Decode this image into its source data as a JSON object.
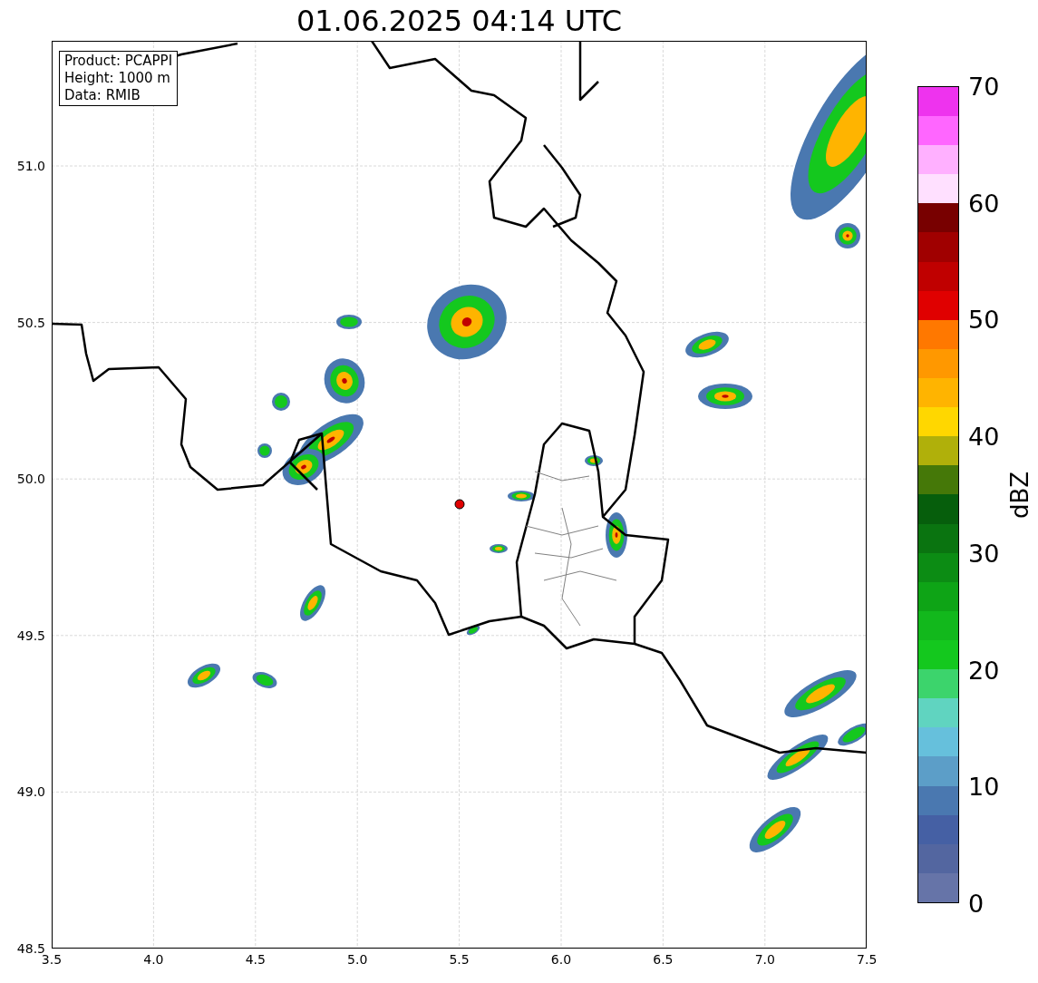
{
  "title": "01.06.2025 04:14 UTC",
  "info_box": {
    "lines": [
      "Product: PCAPPI",
      "Height: 1000 m",
      "Data: RMIB"
    ]
  },
  "map": {
    "x_ticks": [
      "3.5",
      "4.0",
      "4.5",
      "5.0",
      "5.5",
      "6.0",
      "6.5",
      "7.0",
      "7.5"
    ],
    "y_ticks": [
      "51.0",
      "50.5",
      "50.0",
      "49.5",
      "49.0",
      "48.5"
    ]
  },
  "colorbar": {
    "label": "dBZ",
    "ticks": [
      "70",
      "60",
      "50",
      "40",
      "30",
      "20",
      "10",
      "0"
    ],
    "bins": [
      {
        "color": "#6674a8"
      },
      {
        "color": "#5366a0"
      },
      {
        "color": "#4560a4"
      },
      {
        "color": "#4a78b0"
      },
      {
        "color": "#5c9ec8"
      },
      {
        "color": "#66c0dc"
      },
      {
        "color": "#60d4c0"
      },
      {
        "color": "#3cd46c"
      },
      {
        "color": "#14c81e"
      },
      {
        "color": "#12b81c"
      },
      {
        "color": "#0ea416"
      },
      {
        "color": "#0c8c14"
      },
      {
        "color": "#0a7410"
      },
      {
        "color": "#065e0c"
      },
      {
        "color": "#457808"
      },
      {
        "color": "#b0b00a"
      },
      {
        "color": "#ffd700"
      },
      {
        "color": "#ffb400"
      },
      {
        "color": "#ff9800"
      },
      {
        "color": "#ff7800"
      },
      {
        "color": "#e00000"
      },
      {
        "color": "#c00000"
      },
      {
        "color": "#a00000"
      },
      {
        "color": "#780000"
      },
      {
        "color": "#ffe0ff"
      },
      {
        "color": "#ffb0ff"
      },
      {
        "color": "#ff66ff"
      },
      {
        "color": "#ee33ee"
      }
    ]
  }
}
